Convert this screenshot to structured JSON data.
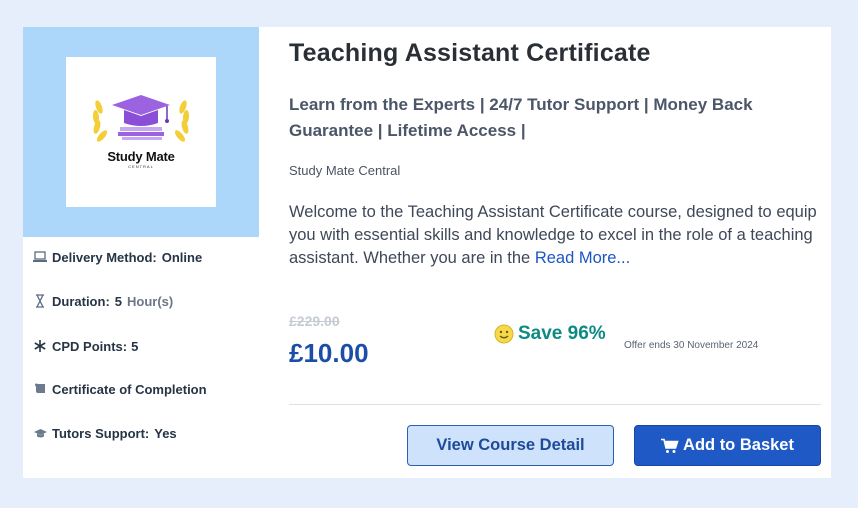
{
  "logo": {
    "name": "Study Mate",
    "sub": "CENTRAL"
  },
  "meta": {
    "delivery_label": "Delivery Method:",
    "delivery_value": "Online",
    "duration_label": "Duration:",
    "duration_value": "5",
    "duration_unit": "Hour(s)",
    "cpd_label": "CPD Points:",
    "cpd_value": "5",
    "certificate_label": "Certificate of Completion",
    "tutor_label": "Tutors Support:",
    "tutor_value": "Yes"
  },
  "course": {
    "title": "Teaching Assistant Certificate",
    "tagline": "Learn from the Experts | 24/7 Tutor Support | Money Back Guarantee | Lifetime Access |",
    "provider": "Study Mate Central",
    "description": "Welcome to the Teaching Assistant Certificate course, designed to equip you with essential skills and knowledge to excel in the role of a teaching assistant. Whether you are in the",
    "read_more": "Read More..."
  },
  "pricing": {
    "old_price": "£229.00",
    "price": "£10.00",
    "save": "Save 96%",
    "offer_ends": "Offer ends 30 November 2024"
  },
  "buttons": {
    "view_detail": "View Course Detail",
    "add_basket": "Add to Basket"
  },
  "icons": {
    "delivery": "laptop-icon",
    "duration": "hourglass-icon",
    "cpd": "asterisk-icon",
    "certificate": "scroll-icon",
    "tutor": "graduation-cap-icon",
    "save": "smiley-icon",
    "basket": "cart-icon"
  },
  "colors": {
    "page_bg": "#e6eefb",
    "logo_panel": "#acd6fa",
    "price": "#1c4ea8",
    "save": "#0e8a84",
    "button_primary": "#1f59c6",
    "button_secondary": "#cfe2fb"
  }
}
